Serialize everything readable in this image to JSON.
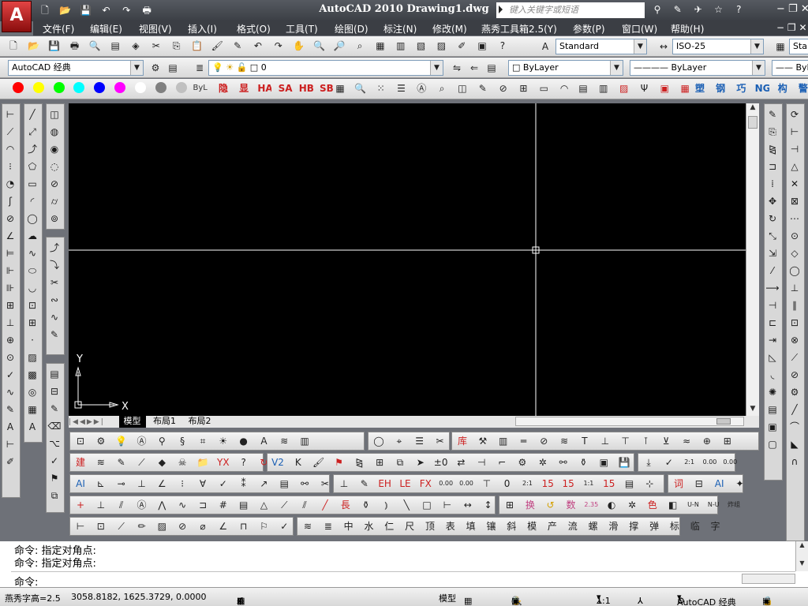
{
  "window": {
    "title": "AutoCAD 2010  Drawing1.dwg",
    "search_placeholder": "键入关键字或短语",
    "logo_letter": "A",
    "controls": {
      "minimize": "−",
      "restore": "❐",
      "close": "✕"
    },
    "title_tools": {
      "binoculars": "⚲",
      "star": "☆",
      "help": "?"
    }
  },
  "menubar": {
    "items": [
      "文件(F)",
      "编辑(E)",
      "视图(V)",
      "插入(I)",
      "格式(O)",
      "工具(T)",
      "绘图(D)",
      "标注(N)",
      "修改(M)",
      "燕秀工具箱2.5(Y)",
      "参数(P)",
      "窗口(W)",
      "帮助(H)"
    ]
  },
  "toolbar_standard": {
    "text_style": "Standard",
    "dim_style": "ISO-25",
    "table_style_partial": "Sta"
  },
  "toolbar_workspace": {
    "workspace": "AutoCAD 经典",
    "layer": "0",
    "color": "ByLayer",
    "linetype": "ByLayer",
    "lineweight_partial": "ByL"
  },
  "toolbar_colors": {
    "colors": [
      "#ff0000",
      "#ffff00",
      "#00ff00",
      "#00ffff",
      "#0000ff",
      "#ff00ff",
      "#ffffff",
      "#808080",
      "#c0c0c0"
    ],
    "bylayer_short": "ByL",
    "yanxiu_labels": [
      "隐",
      "显",
      "HA",
      "SA",
      "HB",
      "SB"
    ],
    "right_labels": [
      "塑",
      "钢",
      "巧",
      "NG",
      "构",
      "警"
    ]
  },
  "canvas": {
    "background": "#000000",
    "ucs_y": "Y",
    "ucs_x": "X"
  },
  "layout_tabs": [
    "模型",
    "布局1",
    "布局2"
  ],
  "bottom_toolbars": {
    "row2_labels": [
      "建",
      "YX",
      "V2",
      "±0"
    ],
    "row3_labels": [
      "AI",
      "1:1",
      "2:1",
      "AI"
    ],
    "row5_labels": [
      "中",
      "水",
      "仁",
      "尺",
      "顶",
      "表",
      "填",
      "镶",
      "斜",
      "模",
      "产",
      "流",
      "螺",
      "滑",
      "撑",
      "弹",
      "标",
      "临",
      "字"
    ],
    "row4_labels": [
      "長",
      "换",
      "数",
      "U-N",
      "N-U",
      "炸组"
    ]
  },
  "command": {
    "history": [
      "命令: 指定对角点:",
      "命令: 指定对角点:"
    ],
    "prompt": "命令:"
  },
  "statusbar": {
    "text_height": "燕秀字高=2.5",
    "coordinates": "3058.8182, 1625.3729, 0.0000",
    "model": "模型",
    "annotation_scale": "1:1",
    "workspace": "AutoCAD 经典"
  }
}
